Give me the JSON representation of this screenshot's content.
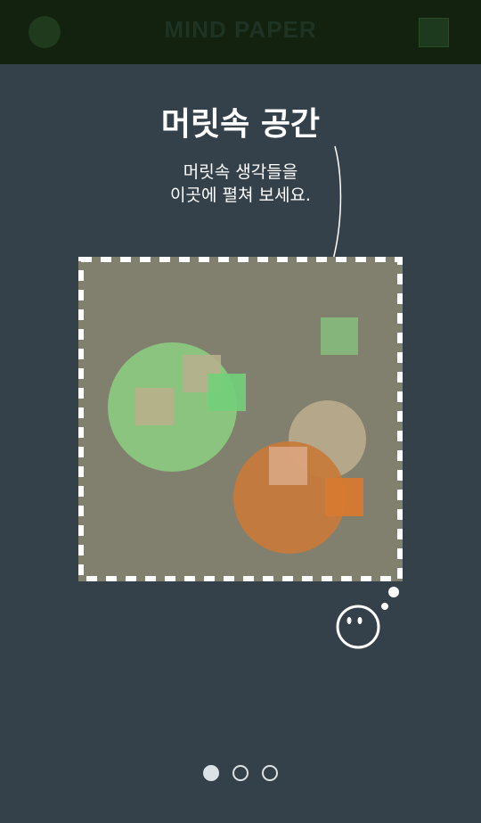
{
  "header": {
    "title": "MIND PAPER",
    "menu_icon": "circle-menu-icon",
    "action_icon": "square-icon"
  },
  "intro": {
    "title": "머릿속 공간",
    "subtitle_line1": "머릿속 생각들을",
    "subtitle_line2": "이곳에 펼쳐 보세요."
  },
  "canvas": {
    "background": "#817f6e",
    "border_style": "dashed-white"
  },
  "shape_colors": {
    "green": "#8bc47e",
    "beige": "#b5a88a",
    "peach": "#d9a784",
    "orange": "#c8793a",
    "bright_green": "#72d07a",
    "soft_green": "#86b57c"
  },
  "mascot": {
    "icon": "thinking-face-icon"
  },
  "pagination": {
    "total": 3,
    "current": 1
  }
}
